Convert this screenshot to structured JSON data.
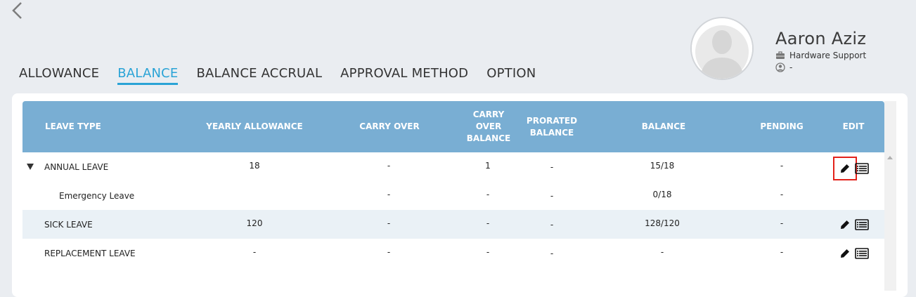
{
  "profile": {
    "name": "Aaron Aziz",
    "department": "Hardware Support",
    "manager": "-"
  },
  "tabs": [
    {
      "label": "ALLOWANCE",
      "active": false
    },
    {
      "label": "BALANCE",
      "active": true
    },
    {
      "label": "BALANCE ACCRUAL",
      "active": false
    },
    {
      "label": "APPROVAL METHOD",
      "active": false
    },
    {
      "label": "OPTION",
      "active": false
    }
  ],
  "colors": {
    "background": "#eaedf1",
    "header": "#79aed3",
    "accent": "#2aa3d6",
    "row_shade": "#eaf1f6",
    "highlight": "#e3221b"
  },
  "table": {
    "headers": {
      "leave_type": "LEAVE TYPE",
      "yearly_allowance": "YEARLY ALLOWANCE",
      "carry_over": "CARRY OVER",
      "carry_over_balance_1": "CARRY",
      "carry_over_balance_2": "OVER",
      "carry_over_balance_3": "BALANCE",
      "prorated_1": "PRORATED",
      "prorated_2": "BALANCE",
      "balance": "BALANCE",
      "pending": "PENDING",
      "edit": "EDIT"
    },
    "rows": [
      {
        "leave_type": "ANNUAL LEAVE",
        "yearly_allowance": "18",
        "carry_over": "-",
        "carry_over_balance": "1",
        "prorated_balance": "-",
        "balance": "15/18",
        "pending": "-"
      },
      {
        "leave_type": "Emergency Leave",
        "yearly_allowance": "",
        "carry_over": "-",
        "carry_over_balance": "-",
        "prorated_balance": "-",
        "balance": "0/18",
        "pending": "-"
      },
      {
        "leave_type": "SICK LEAVE",
        "yearly_allowance": "120",
        "carry_over": "-",
        "carry_over_balance": "-",
        "prorated_balance": "-",
        "balance": "128/120",
        "pending": "-"
      },
      {
        "leave_type": "REPLACEMENT LEAVE",
        "yearly_allowance": "-",
        "carry_over": "-",
        "carry_over_balance": "-",
        "prorated_balance": "-",
        "balance": "-",
        "pending": "-"
      }
    ]
  }
}
